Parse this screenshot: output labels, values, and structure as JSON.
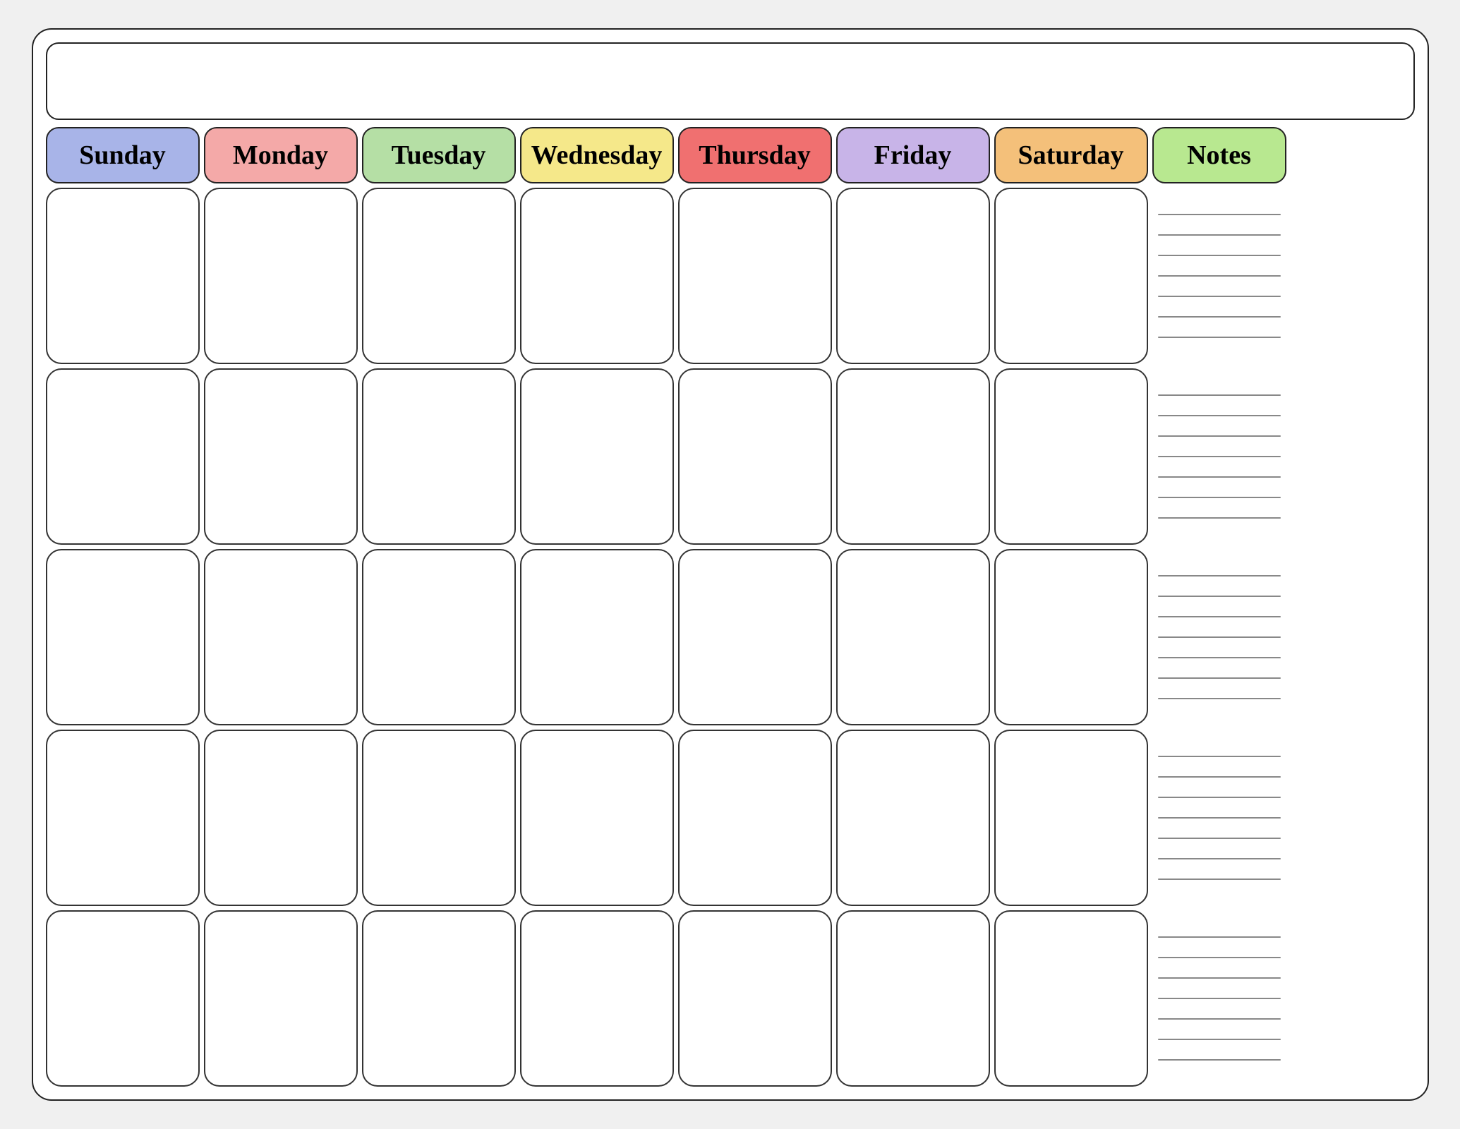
{
  "calendar": {
    "title": "",
    "header": {
      "days": [
        {
          "id": "sunday",
          "label": "Sunday",
          "class": "header-sunday"
        },
        {
          "id": "monday",
          "label": "Monday",
          "class": "header-monday"
        },
        {
          "id": "tuesday",
          "label": "Tuesday",
          "class": "header-tuesday"
        },
        {
          "id": "wednesday",
          "label": "Wednesday",
          "class": "header-wednesday"
        },
        {
          "id": "thursday",
          "label": "Thursday",
          "class": "header-thursday"
        },
        {
          "id": "friday",
          "label": "Friday",
          "class": "header-friday"
        },
        {
          "id": "saturday",
          "label": "Saturday",
          "class": "header-saturday"
        },
        {
          "id": "notes",
          "label": "Notes",
          "class": "header-notes"
        }
      ]
    },
    "weeks": 5,
    "note_lines_per_week": 7
  }
}
